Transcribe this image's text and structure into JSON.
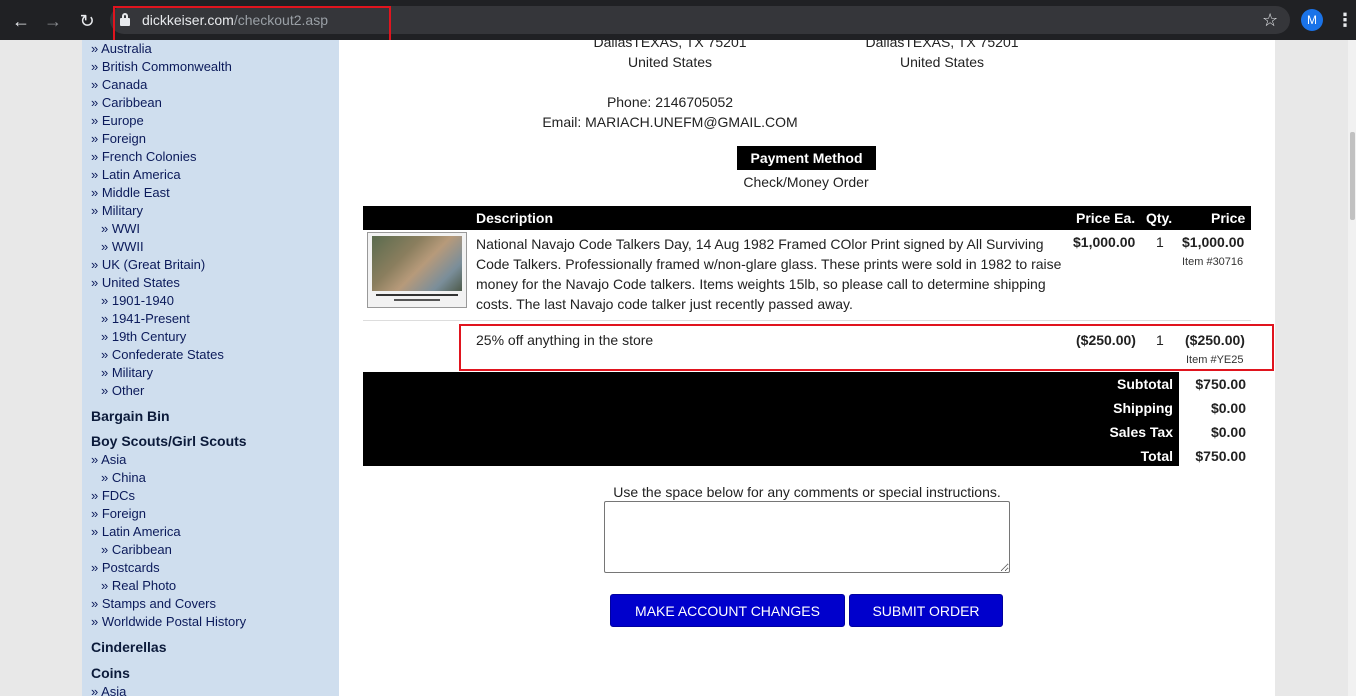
{
  "browser": {
    "url_host": "dickkeiser.com",
    "url_path": "/checkout2.asp",
    "profile_initial": "M",
    "back_icon": "←",
    "forward_icon": "→",
    "reload_icon": "↻",
    "star_icon": "☆",
    "menu_icon": "⋮"
  },
  "sidebar": {
    "items": [
      {
        "label": "» Australia",
        "level": 1
      },
      {
        "label": "» British Commonwealth",
        "level": 1
      },
      {
        "label": "» Canada",
        "level": 1
      },
      {
        "label": "» Caribbean",
        "level": 1
      },
      {
        "label": "» Europe",
        "level": 1
      },
      {
        "label": "» Foreign",
        "level": 1
      },
      {
        "label": "» French Colonies",
        "level": 1
      },
      {
        "label": "» Latin America",
        "level": 1
      },
      {
        "label": "» Middle East",
        "level": 1
      },
      {
        "label": "» Military",
        "level": 1
      },
      {
        "label": "» WWI",
        "level": 2
      },
      {
        "label": "» WWII",
        "level": 2
      },
      {
        "label": "» UK (Great Britain)",
        "level": 1
      },
      {
        "label": "» United States",
        "level": 1
      },
      {
        "label": "» 1901-1940",
        "level": 2
      },
      {
        "label": "» 1941-Present",
        "level": 2
      },
      {
        "label": "» 19th Century",
        "level": 2
      },
      {
        "label": "» Confederate States",
        "level": 2
      },
      {
        "label": "» Military",
        "level": 2
      },
      {
        "label": "» Other",
        "level": 2
      }
    ],
    "heading_bargain": "Bargain Bin",
    "heading_scouts": "Boy Scouts/Girl Scouts",
    "scouts_items": [
      {
        "label": "» Asia",
        "level": 1
      },
      {
        "label": "» China",
        "level": 2
      },
      {
        "label": "» FDCs",
        "level": 1
      },
      {
        "label": "» Foreign",
        "level": 1
      },
      {
        "label": "» Latin America",
        "level": 1
      },
      {
        "label": "» Caribbean",
        "level": 2
      },
      {
        "label": "» Postcards",
        "level": 1
      },
      {
        "label": "» Real Photo",
        "level": 2
      },
      {
        "label": "» Stamps and Covers",
        "level": 1
      },
      {
        "label": "» Worldwide Postal History",
        "level": 1
      }
    ],
    "heading_cinderellas": "Cinderellas",
    "heading_coins": "Coins",
    "coins_first": "» Asia"
  },
  "address": {
    "billing_city": "DallasTEXAS, TX 75201",
    "billing_country": "United States",
    "shipping_city": "DallasTEXAS, TX 75201",
    "shipping_country": "United States",
    "phone": "Phone: 2146705052",
    "email": "Email: MARIACH.UNEFM@GMAIL.COM"
  },
  "payment": {
    "heading": "Payment Method",
    "method": "Check/Money Order"
  },
  "table": {
    "headers": {
      "description": "Description",
      "price_ea": "Price Ea.",
      "qty": "Qty.",
      "price": "Price"
    },
    "rows": [
      {
        "description": "National Navajo Code Talkers Day, 14 Aug 1982 Framed COlor Print signed by All Surviving Code Talkers. Professionally framed w/non-glare glass. These prints were sold in 1982 to raise money for the Navajo Code talkers. Items weights 15lb, so please call to determine shipping costs. The last Navajo code talker just recently passed away.",
        "price_ea": "$1,000.00",
        "qty": "1",
        "price": "$1,000.00",
        "item_no": "Item #30716"
      },
      {
        "description": "25% off anything in the store",
        "price_ea": "($250.00)",
        "qty": "1",
        "price": "($250.00)",
        "item_no": "Item #YE25"
      }
    ]
  },
  "totals": {
    "subtotal_label": "Subtotal",
    "subtotal": "$750.00",
    "shipping_label": "Shipping",
    "shipping": "$0.00",
    "tax_label": "Sales Tax",
    "tax": "$0.00",
    "total_label": "Total",
    "total": "$750.00"
  },
  "comments": {
    "label": "Use the space below for any comments or special instructions.",
    "value": ""
  },
  "buttons": {
    "account": "MAKE ACCOUNT CHANGES",
    "submit": "SUBMIT ORDER"
  },
  "colors": {
    "sidebar_bg": "#cfdeee",
    "button_blue": "#0000cc",
    "highlight_red": "#e0141e"
  }
}
